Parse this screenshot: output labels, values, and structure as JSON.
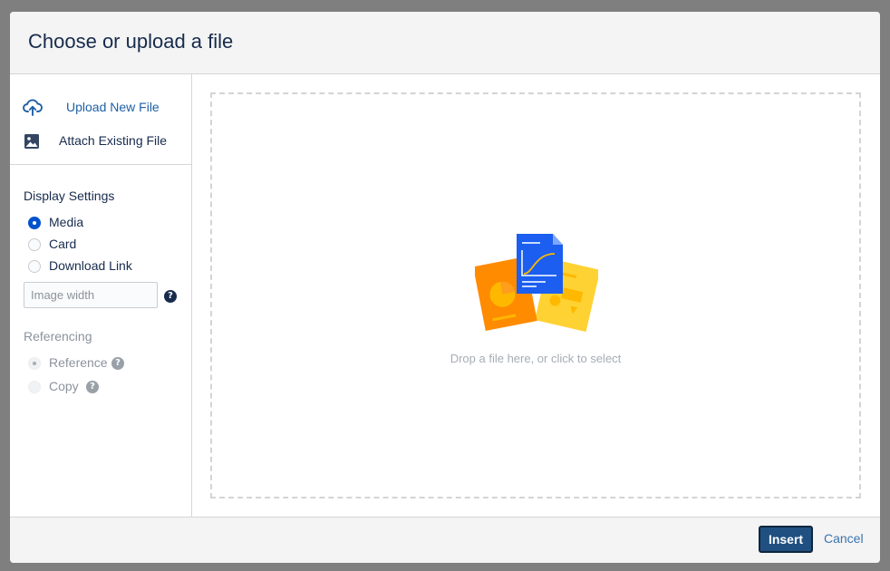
{
  "dialog": {
    "title": "Choose or upload a file"
  },
  "sidebar": {
    "nav": [
      {
        "label": "Upload New File",
        "icon": "cloud-upload-icon",
        "active": true
      },
      {
        "label": "Attach Existing File",
        "icon": "image-icon",
        "active": false
      }
    ],
    "display_settings": {
      "title": "Display Settings",
      "options": [
        {
          "label": "Media",
          "checked": true
        },
        {
          "label": "Card",
          "checked": false
        },
        {
          "label": "Download Link",
          "checked": false
        }
      ],
      "image_width": {
        "value": "",
        "placeholder": "Image width"
      },
      "help_glyph": "?"
    },
    "referencing": {
      "title": "Referencing",
      "disabled": true,
      "options": [
        {
          "label": "Reference",
          "checked": true,
          "help_glyph": "?"
        },
        {
          "label": "Copy",
          "checked": false,
          "help_glyph": "?"
        }
      ]
    }
  },
  "dropzone": {
    "text": "Drop a file here, or click to select"
  },
  "footer": {
    "insert_label": "Insert",
    "cancel_label": "Cancel"
  },
  "colors": {
    "primary": "#205081",
    "link": "#3b73af",
    "radio_checked": "#0052cc",
    "text": "#172b4d",
    "muted": "#8c939d",
    "illustration_blue": "#1b5ef0",
    "illustration_orange": "#ff8b00",
    "illustration_yellow": "#ffd233"
  }
}
